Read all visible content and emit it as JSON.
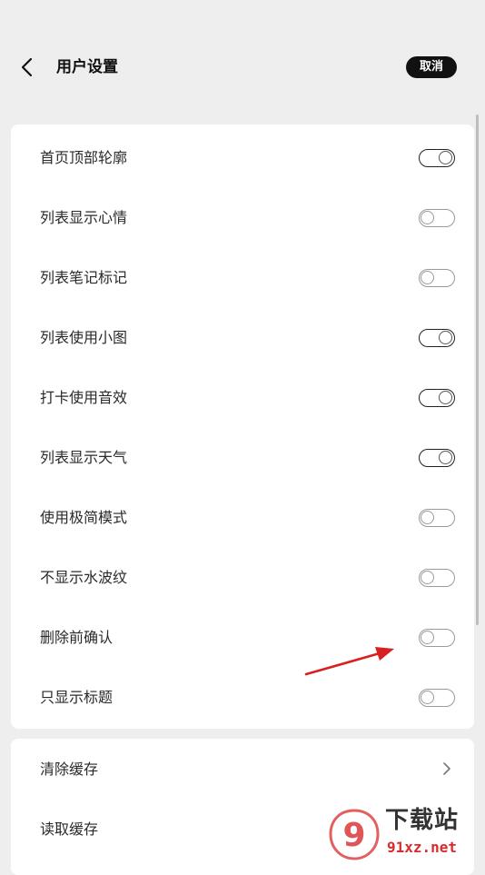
{
  "header": {
    "title": "用户设置",
    "cancel_label": "取消"
  },
  "settings": [
    {
      "label": "首页顶部轮廓",
      "enabled": true
    },
    {
      "label": "列表显示心情",
      "enabled": false
    },
    {
      "label": "列表笔记标记",
      "enabled": false
    },
    {
      "label": "列表使用小图",
      "enabled": true
    },
    {
      "label": "打卡使用音效",
      "enabled": true
    },
    {
      "label": "列表显示天气",
      "enabled": true
    },
    {
      "label": "使用极简模式",
      "enabled": false
    },
    {
      "label": "不显示水波纹",
      "enabled": false
    },
    {
      "label": "删除前确认",
      "enabled": false
    },
    {
      "label": "只显示标题",
      "enabled": false
    }
  ],
  "cache": [
    {
      "label": "清除缓存"
    },
    {
      "label": "读取缓存"
    }
  ],
  "watermark": {
    "badge": "9",
    "title": "下载站",
    "url": "91xz.net"
  },
  "colors": {
    "annotation_arrow": "#d92020",
    "watermark_red": "#d92b2b"
  }
}
